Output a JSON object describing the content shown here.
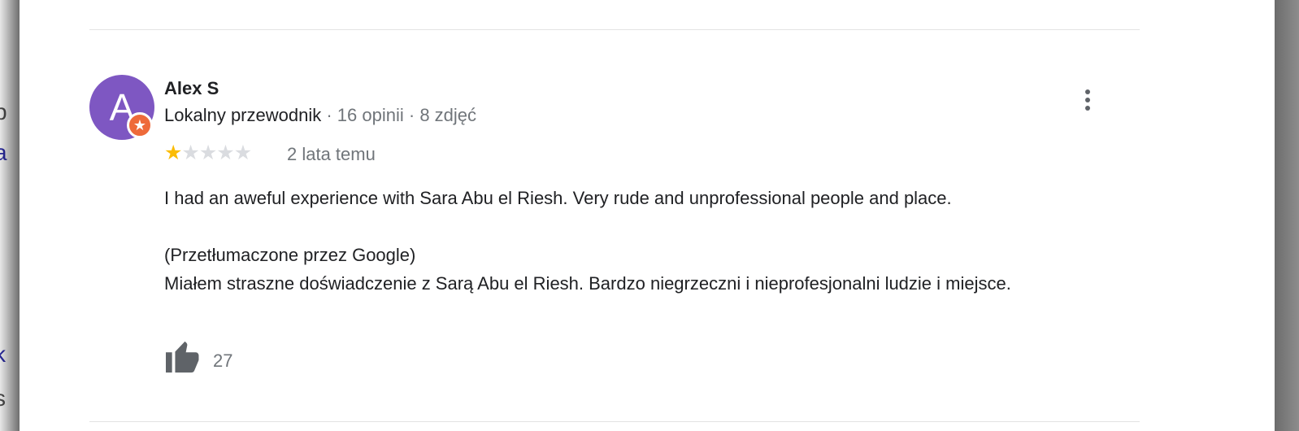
{
  "review": {
    "author": {
      "initial": "A",
      "name": "Alex S",
      "badge": "local-guide-star-icon",
      "role": "Lokalny przewodnik",
      "separator": " · ",
      "reviews_count": "16 opinii",
      "photos_count": "8 zdjęć"
    },
    "rating": {
      "value": 1,
      "max": 5
    },
    "date": "2 lata temu",
    "text_original": "I had an aweful experience with Sara Abu el Riesh. Very rude and unprofessional people and place.",
    "translated_label": "(Przetłumaczone przez Google)",
    "text_translated": "Miałem straszne doświadczenie z Sarą Abu el Riesh. Bardzo niegrzeczni i nieprofesjonalni ludzie i miejsce.",
    "likes": "27",
    "menu_icon": "more-vert-icon",
    "like_icon": "thumb-up-icon"
  },
  "colors": {
    "avatar": "#7e57c2",
    "badge": "#ee6a3a",
    "star_filled": "#fbbc04",
    "star_empty": "#dadce0",
    "secondary_text": "#70757a"
  }
}
